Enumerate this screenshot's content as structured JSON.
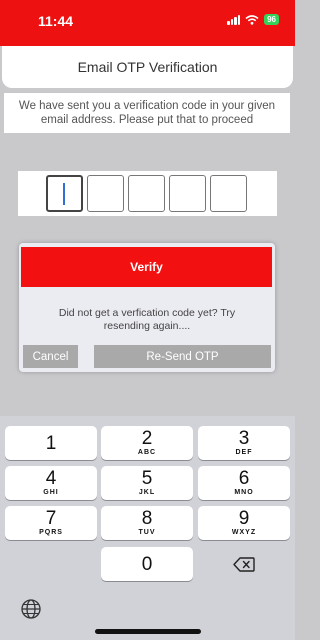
{
  "status_bar": {
    "time": "11:44",
    "battery": "96"
  },
  "header": {
    "title": "Email OTP Verification"
  },
  "message": "We have sent you a verification code in your given email address. Please put that to proceed",
  "otp": {
    "digits": [
      "",
      "",
      "",
      "",
      ""
    ]
  },
  "dialog": {
    "verify_label": "Verify",
    "message": "Did not get a verfication code yet? Try resending again....",
    "cancel_label": "Cancel",
    "resend_label": "Re-Send OTP"
  },
  "keyboard": {
    "keys": [
      {
        "digit": "1",
        "letters": ""
      },
      {
        "digit": "2",
        "letters": "ABC"
      },
      {
        "digit": "3",
        "letters": "DEF"
      },
      {
        "digit": "4",
        "letters": "GHI"
      },
      {
        "digit": "5",
        "letters": "JKL"
      },
      {
        "digit": "6",
        "letters": "MNO"
      },
      {
        "digit": "7",
        "letters": "PQRS"
      },
      {
        "digit": "8",
        "letters": "TUV"
      },
      {
        "digit": "9",
        "letters": "WXYZ"
      },
      {
        "digit": "0",
        "letters": ""
      }
    ],
    "backspace_icon": "backspace-icon",
    "globe_icon": "globe-icon"
  },
  "colors": {
    "status_bar": "#ee1111",
    "verify_button": "#f21010",
    "secondary_button": "#a9a9a9",
    "background": "#c9c9cc"
  }
}
